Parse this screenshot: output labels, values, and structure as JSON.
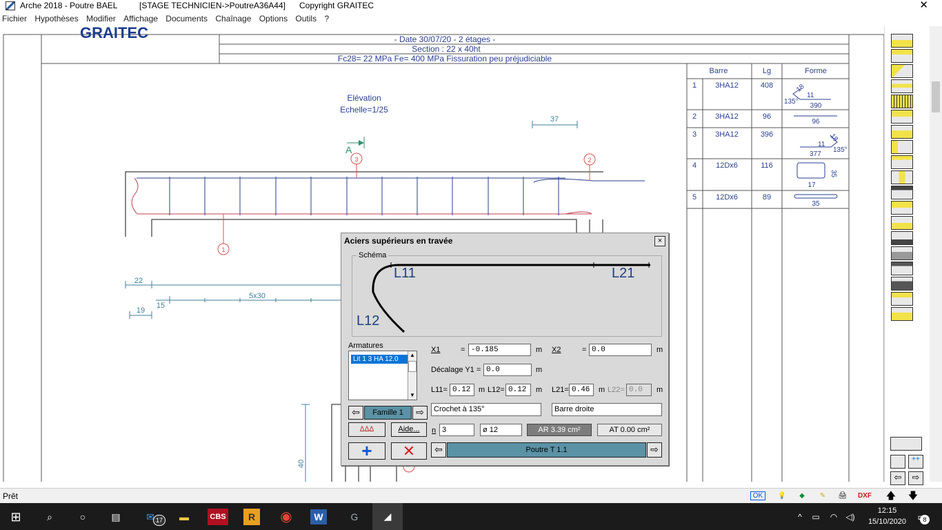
{
  "titlebar": {
    "app_title": "Arche 2018 - Poutre BAEL",
    "file_path": "[STAGE TECHNICIEN->PoutreA36A44]",
    "copyright": "Copyright GRAITEC"
  },
  "menu": [
    "Fichier",
    "Hypothèses",
    "Modifier",
    "Affichage",
    "Documents",
    "Chaînage",
    "Options",
    "Outils",
    "?"
  ],
  "header": {
    "logo": "GRAITEC",
    "line1": "- Date 30/07/20 - 2 étages -",
    "line2": "Section :  22 x  40ht",
    "line3": "Fc28=   22 MPa Fe=  400 MPa Fissuration peu préjudiciable"
  },
  "drawing": {
    "elevation_title": "Elévation",
    "scale": "Echelle=1/25",
    "section_mark": "A",
    "dim_37": "37",
    "dim_22": "22",
    "dim_15": "15",
    "dim_19": "19",
    "dim_5x30": "5x30",
    "dim_40": "40",
    "markers": [
      "1",
      "2",
      "3"
    ]
  },
  "bar_table": {
    "headers": [
      "Barre",
      "Lg",
      "Forme"
    ],
    "rows": [
      {
        "num": "1",
        "bar": "3HA12",
        "lg": "408",
        "shape": [
          "18",
          "11",
          "135°",
          "390"
        ]
      },
      {
        "num": "2",
        "bar": "3HA12",
        "lg": "96",
        "shape": [
          "96"
        ]
      },
      {
        "num": "3",
        "bar": "3HA12",
        "lg": "396",
        "shape": [
          "18",
          "11",
          "377",
          "135°"
        ]
      },
      {
        "num": "4",
        "bar": "12Dx6",
        "lg": "116",
        "shape": [
          "35",
          "17"
        ]
      },
      {
        "num": "5",
        "bar": "12Dx6",
        "lg": "89",
        "shape": [
          "35"
        ]
      }
    ]
  },
  "dialog": {
    "title": "Aciers supérieurs en travée",
    "close": "×",
    "schema_label": "Schéma",
    "schema_l11": "L11",
    "schema_l21": "L21",
    "schema_l12": "L12",
    "armatures_label": "Armatures",
    "armatures_items": [
      "Lit 1 3 HA 12.0"
    ],
    "x1_label": "X1",
    "x1_value": "-0.185",
    "x2_label": "X2",
    "x2_value": "0.0",
    "unit_m": "m",
    "decalage_label": "Décalage Y1 =",
    "decalage_value": "0.0",
    "l11_label": "L11=",
    "l11_value": "0.12",
    "l12_label": "L12=",
    "l12_value": "0.12",
    "l21_label": "L21=",
    "l21_value": "0.46",
    "l22_label": "L22=",
    "l22_value": "0.0",
    "famille": "Famille 1",
    "crochet": "Crochet à 135°",
    "barre_droite": "Barre droite",
    "aide": "Aide...",
    "n_label": "n",
    "n_value": "3",
    "diameter": "ø 12",
    "ar": "AR 3.39 cm²",
    "at": "AT 0.00 cm²",
    "poutre": "Poutre T 1.1",
    "eq": "="
  },
  "status": {
    "text": "Prêt",
    "ok": "OK",
    "dxf": "DXF"
  },
  "taskbar": {
    "badge_mail": "17",
    "cbs_label": "CBS",
    "time": "12:15",
    "date": "15/10/2020",
    "notif": "8"
  },
  "colors": {
    "drawing_blue": "#2a3f8f",
    "dim_teal": "#3f7f9a",
    "marker_red": "#d9534f",
    "highlight": "#0a74d6",
    "famille_bg": "#5b92a5"
  }
}
